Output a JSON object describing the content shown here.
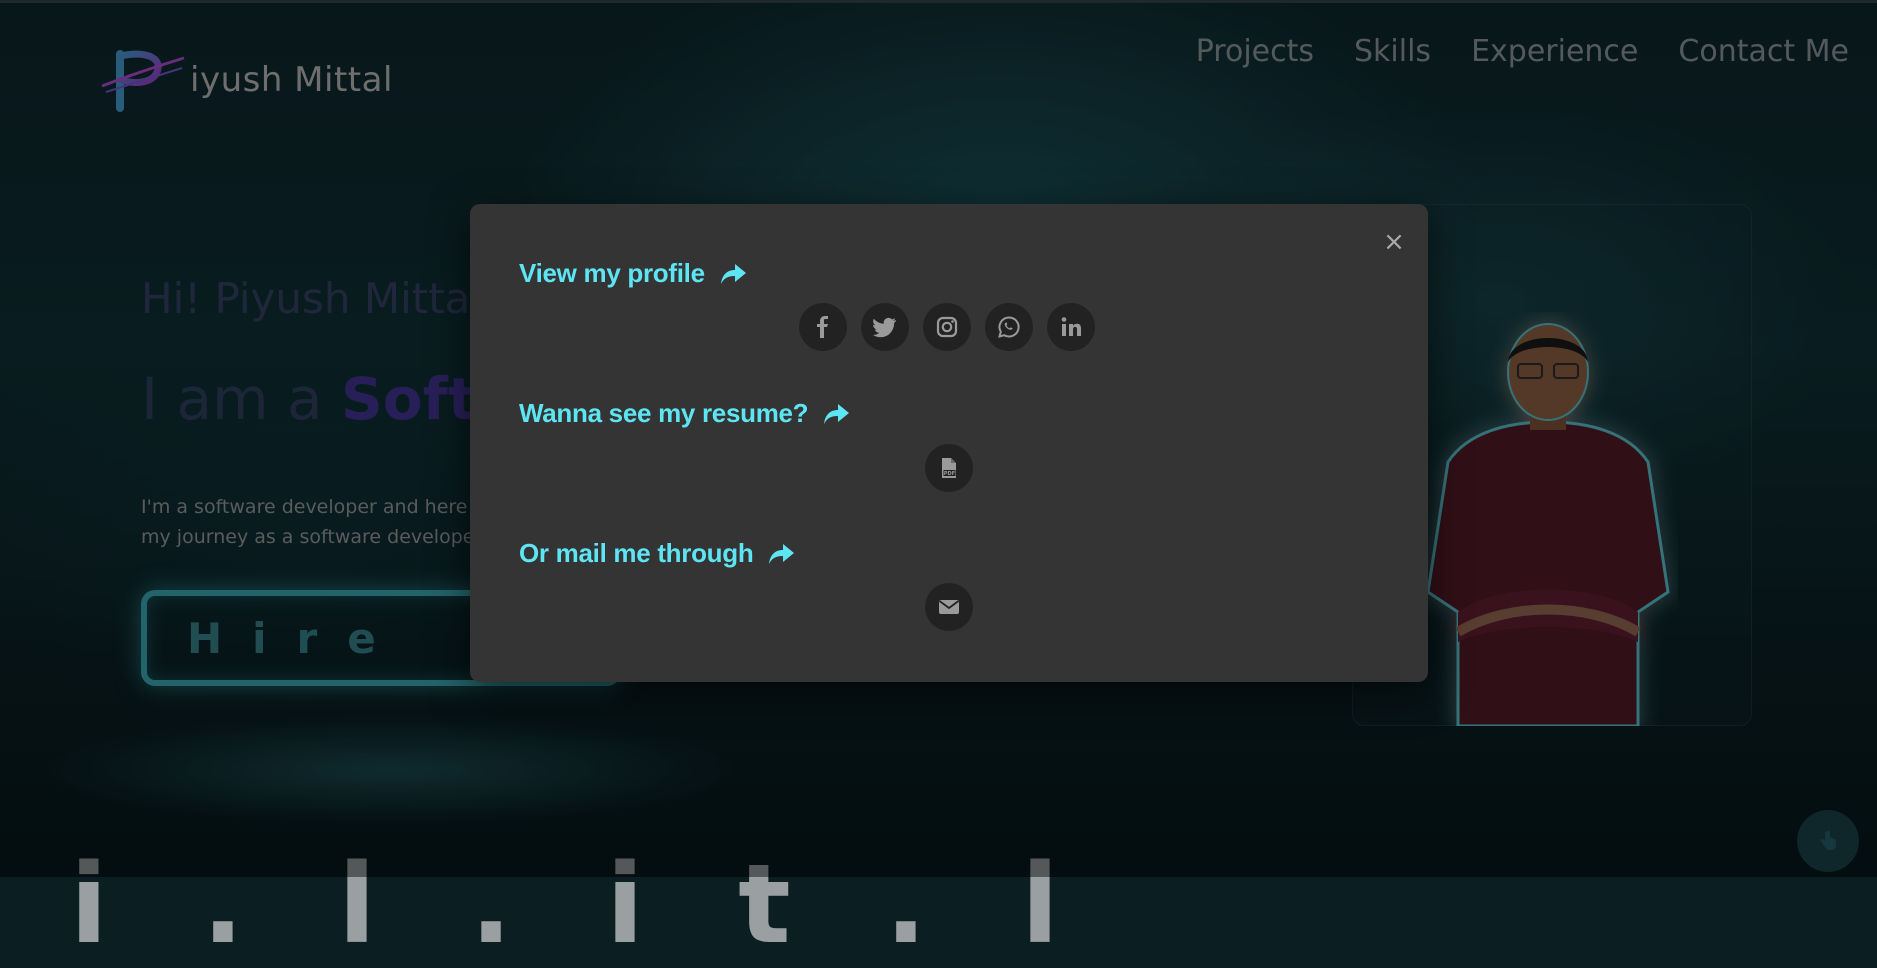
{
  "header": {
    "logo_text": "iyush Mittal",
    "nav": [
      "Projects",
      "Skills",
      "Experience",
      "Contact Me"
    ]
  },
  "hero": {
    "greeting": "Hi! Piyush Mittal",
    "iam_prefix": "I am a ",
    "role_visible": "Softw",
    "description": "I'm a software developer and here my journey as a software develope",
    "hire_button": "Hire",
    "bottom_text": "i  .  l    .  i  t  .  l"
  },
  "modal": {
    "close_symbol": "×",
    "profile_title": "View my profile",
    "resume_title": "Wanna see my resume?",
    "mail_title": "Or mail me through",
    "social_icons": [
      "facebook-icon",
      "twitter-icon",
      "instagram-icon",
      "whatsapp-icon",
      "linkedin-icon"
    ],
    "resume_icon": "pdf-file-icon",
    "mail_icon": "envelope-icon"
  },
  "colors": {
    "accent": "#5ee5f3",
    "modal_bg": "#343434",
    "icon_circle": "#222222",
    "hire_border": "#3fb6c2",
    "role_color": "#4b3aa0"
  }
}
